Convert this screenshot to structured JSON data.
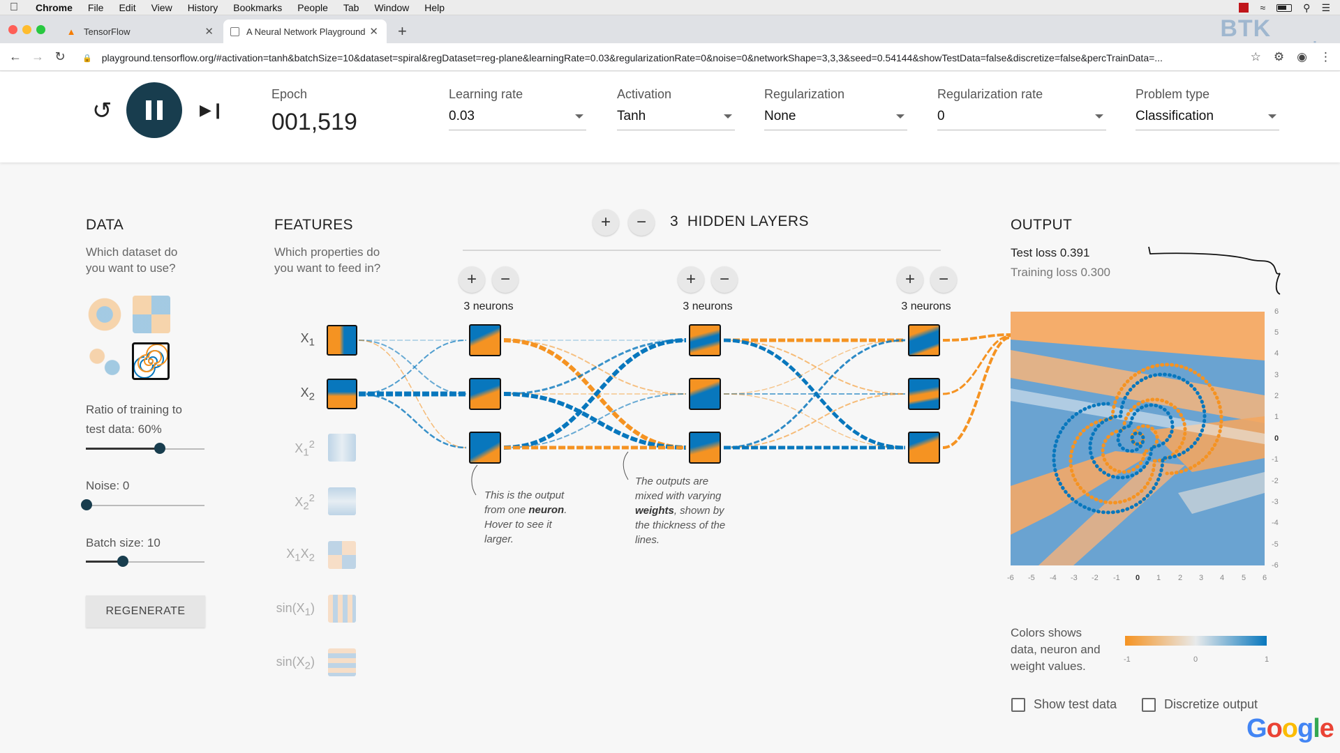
{
  "menubar": {
    "app": "Chrome",
    "items": [
      "File",
      "Edit",
      "View",
      "History",
      "Bookmarks",
      "People",
      "Tab",
      "Window",
      "Help"
    ]
  },
  "tabs": [
    {
      "title": "TensorFlow",
      "active": false
    },
    {
      "title": "A Neural Network Playground",
      "active": true
    }
  ],
  "watermark": {
    "line1": "BTK",
    "line2": "AKADEMİ"
  },
  "address": {
    "url": "playground.tensorflow.org/#activation=tanh&batchSize=10&dataset=spiral&regDataset=reg-plane&learningRate=0.03&regularizationRate=0&noise=0&networkShape=3,3,3&seed=0.54144&showTestData=false&discretize=false&percTrainData=..."
  },
  "header": {
    "epoch_label": "Epoch",
    "epoch_value": "001,519",
    "learning_rate_label": "Learning rate",
    "learning_rate_value": "0.03",
    "activation_label": "Activation",
    "activation_value": "Tanh",
    "regularization_label": "Regularization",
    "regularization_value": "None",
    "reg_rate_label": "Regularization rate",
    "reg_rate_value": "0",
    "problem_label": "Problem type",
    "problem_value": "Classification"
  },
  "data_panel": {
    "title": "DATA",
    "subtitle_line1": "Which dataset do",
    "subtitle_line2": "you want to use?",
    "ratio_label_line1": "Ratio of training to",
    "ratio_label_line2": "test data:  60%",
    "ratio_value": 60,
    "noise_label": "Noise:  0",
    "noise_value": 0,
    "batch_label": "Batch size:  10",
    "batch_value": 10,
    "regenerate": "REGENERATE"
  },
  "features_panel": {
    "title": "FEATURES",
    "subtitle_line1": "Which properties do",
    "subtitle_line2": "you want to feed in?",
    "features": [
      {
        "base": "X",
        "sub": "1",
        "sup": "",
        "active": true
      },
      {
        "base": "X",
        "sub": "2",
        "sup": "",
        "active": true
      },
      {
        "base": "X",
        "sub": "1",
        "sup": "2",
        "active": false
      },
      {
        "base": "X",
        "sub": "2",
        "sup": "2",
        "active": false
      },
      {
        "base": "X",
        "sub": "1",
        "sup": "",
        "extra": "X",
        "extra_sub": "2",
        "active": false
      },
      {
        "base": "sin(X",
        "sub": "1",
        "sup": "",
        "close": ")",
        "active": false
      },
      {
        "base": "sin(X",
        "sub": "2",
        "sup": "",
        "close": ")",
        "active": false
      }
    ]
  },
  "network": {
    "hidden_count": "3",
    "hidden_label": "HIDDEN LAYERS",
    "layers": [
      {
        "neurons_label": "3 neurons"
      },
      {
        "neurons_label": "3 neurons"
      },
      {
        "neurons_label": "3 neurons"
      }
    ],
    "annotation1": {
      "pre": "This is the output from one ",
      "bold": "neuron",
      "post": ". Hover to see it larger."
    },
    "annotation2": {
      "pre": "The outputs are mixed with varying ",
      "bold": "weights",
      "post": ", shown by the thickness of the lines."
    }
  },
  "output_panel": {
    "title": "OUTPUT",
    "test_loss": "Test loss 0.391",
    "training_loss": "Training loss 0.300",
    "x_ticks": [
      "-6",
      "-5",
      "-4",
      "-3",
      "-2",
      "-1",
      "0",
      "1",
      "2",
      "3",
      "4",
      "5",
      "6"
    ],
    "y_ticks": [
      "6",
      "5",
      "4",
      "3",
      "2",
      "1",
      "0",
      "-1",
      "-2",
      "-3",
      "-4",
      "-5",
      "-6"
    ],
    "legend_text_line1": "Colors shows",
    "legend_text_line2": "data, neuron and",
    "legend_text_line3": "weight values.",
    "legend_ticks": [
      "-1",
      "0",
      "1"
    ],
    "show_test_data": "Show test data",
    "discretize": "Discretize output"
  },
  "colors": {
    "orange": "#f59322",
    "blue": "#0877bd",
    "dark_teal": "#183d4e"
  },
  "brand": "Google"
}
